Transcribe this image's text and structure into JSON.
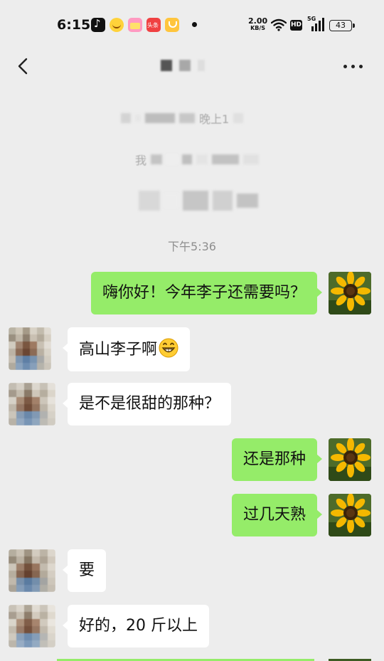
{
  "status_bar": {
    "time": "6:15",
    "speed_value": "2.00",
    "speed_unit": "KB/S",
    "hd_label": "HD",
    "network": "5G",
    "battery": "43",
    "app_icons": [
      "tiktok-icon",
      "emoji-face-icon",
      "gift-icon",
      "toutiao-news-icon",
      "shield-icon"
    ]
  },
  "navbar": {
    "back_icon": "chevron-left-icon",
    "more_icon": "more-dots-icon"
  },
  "notice": {
    "line1_text": "晚上1",
    "line2_text": "我"
  },
  "chat": {
    "timestamp": "下午5:36",
    "messages": [
      {
        "side": "out",
        "text": "嗨你好！今年李子还需要吗？"
      },
      {
        "side": "in",
        "text": "高山李子啊",
        "emoji": "grinning-face-icon"
      },
      {
        "side": "in",
        "text": "是不是很甜的那种？"
      },
      {
        "side": "out",
        "text": "还是那种"
      },
      {
        "side": "out",
        "text": "过几天熟"
      },
      {
        "side": "in",
        "text": "要"
      },
      {
        "side": "in",
        "text": "好的，20 斤以上"
      }
    ]
  },
  "colors": {
    "background": "#ededed",
    "outgoing_bubble": "#95ec69",
    "incoming_bubble": "#ffffff",
    "timestamp_text": "#8e8e8e"
  }
}
